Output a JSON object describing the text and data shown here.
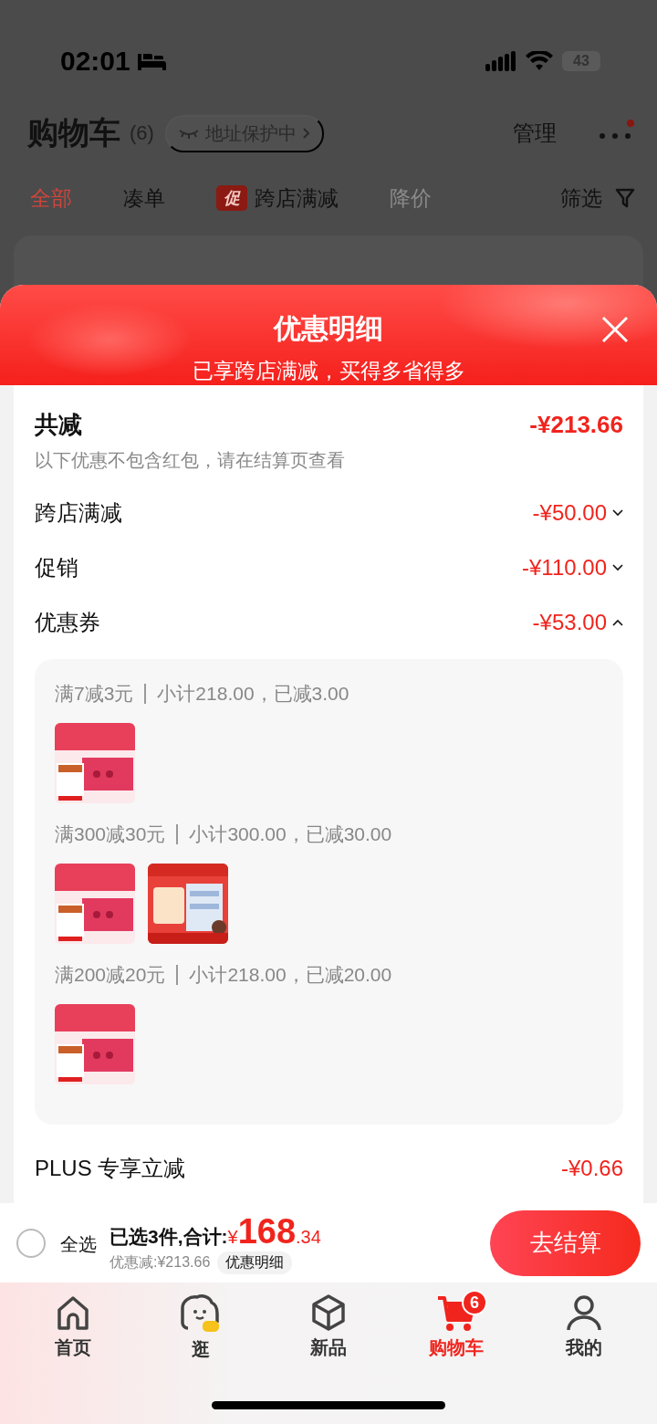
{
  "status_bar": {
    "time": "02:01",
    "battery": "43"
  },
  "header": {
    "title": "购物车",
    "count": "(6)",
    "address_pill": "地址保护中",
    "manage": "管理"
  },
  "filter_tabs": [
    {
      "label": "全部",
      "selected": true,
      "disabled": false
    },
    {
      "label": "凑单",
      "selected": false,
      "disabled": false
    },
    {
      "label": "跨店满减",
      "badge": "促",
      "selected": false,
      "disabled": false
    },
    {
      "label": "降价",
      "selected": false,
      "disabled": true
    }
  ],
  "filter": "筛选",
  "sheet": {
    "title": "优惠明细",
    "subtitle": "已享跨店满减，买得多省得多",
    "total": {
      "label": "共减",
      "amount": "-¥213.66"
    },
    "note": "以下优惠不包含红包，请在结算页查看",
    "discounts": [
      {
        "label": "跨店满减",
        "amount": "-¥50.00",
        "expanded": false
      },
      {
        "label": "促销",
        "amount": "-¥110.00",
        "expanded": false
      },
      {
        "label": "优惠券",
        "amount": "-¥53.00",
        "expanded": true,
        "groups": [
          {
            "rule": "满7减3元",
            "detail": "小计218.00，已减3.00"
          },
          {
            "rule": "满300减30元",
            "detail": "小计300.00，已减30.00"
          },
          {
            "rule": "满200减20元",
            "detail": "小计218.00，已减20.00"
          }
        ]
      }
    ],
    "plus": {
      "label": "PLUS 专享立减",
      "amount": "-¥0.66"
    }
  },
  "checkout": {
    "select_all": {
      "label": "全选",
      "checked": false
    },
    "summary": "已选3件,合计:",
    "currency": "¥",
    "integer": "168",
    "decimal": ".34",
    "saving": "优惠减:¥213.66",
    "detail_button": "优惠明细",
    "checkout_button": "去结算"
  },
  "tabbar": [
    {
      "label": "首页",
      "kind": "home",
      "selected": false
    },
    {
      "label": "逛",
      "kind": "browse",
      "selected": false
    },
    {
      "label": "新品",
      "kind": "new",
      "selected": false
    },
    {
      "label": "购物车",
      "kind": "cart",
      "selected": true,
      "badge": "6"
    },
    {
      "label": "我的",
      "kind": "me",
      "selected": false
    }
  ]
}
